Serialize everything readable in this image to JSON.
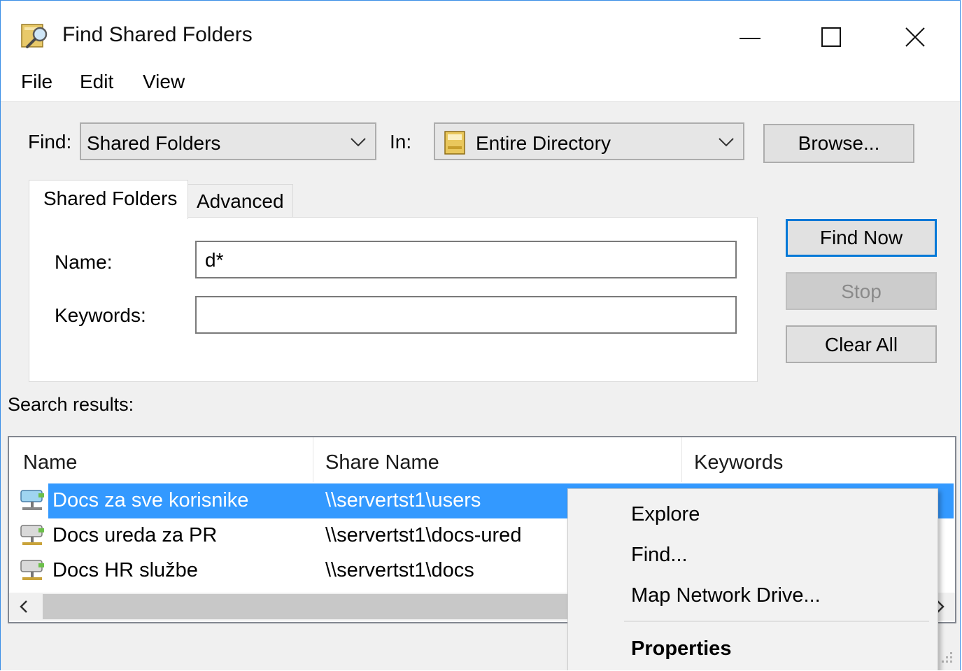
{
  "window": {
    "title": "Find Shared Folders",
    "controls": [
      "minimize-icon",
      "maximize-icon",
      "close-icon"
    ]
  },
  "menu": {
    "file": "File",
    "edit": "Edit",
    "view": "View"
  },
  "search": {
    "find_label": "Find:",
    "find_value": "Shared Folders",
    "in_label": "In:",
    "in_value": "Entire Directory",
    "browse_label": "Browse..."
  },
  "tabs": {
    "shared_folders": "Shared Folders",
    "advanced": "Advanced"
  },
  "form": {
    "name_label": "Name:",
    "name_value": "d*",
    "keywords_label": "Keywords:",
    "keywords_value": ""
  },
  "actions": {
    "find_now": "Find Now",
    "stop": "Stop",
    "clear_all": "Clear All"
  },
  "results": {
    "label": "Search results:",
    "columns": [
      "Name",
      "Share Name",
      "Keywords"
    ],
    "rows": [
      {
        "name": "Docs za sve korisnike",
        "share": "\\\\servertst1\\users",
        "selected": true
      },
      {
        "name": "Docs ureda za PR",
        "share": "\\\\servertst1\\docs-ured",
        "selected": false
      },
      {
        "name": "Docs HR službe",
        "share": "\\\\servertst1\\docs",
        "selected": false
      }
    ]
  },
  "context_menu": {
    "explore": "Explore",
    "find": "Find...",
    "map_drive": "Map Network Drive...",
    "properties": "Properties"
  },
  "colors": {
    "selection": "#3399ff",
    "default_button_border": "#0078d7",
    "window_border": "#3a8ee6"
  }
}
